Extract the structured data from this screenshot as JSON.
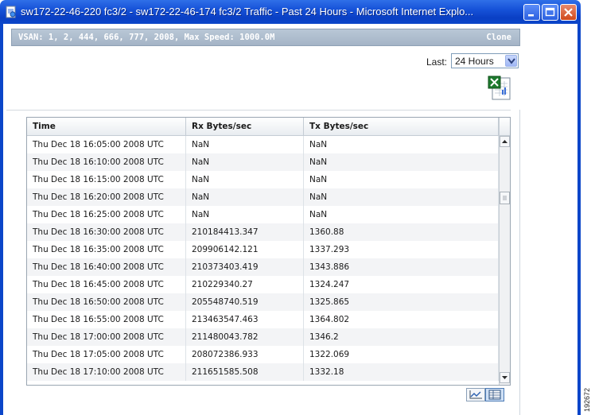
{
  "window": {
    "title": "sw172-22-46-220 fc3/2 - sw172-22-46-174 fc3/2 Traffic - Past 24 Hours - Microsoft Internet Explo..."
  },
  "header": {
    "vsan_info": "VSAN: 1, 2, 444, 666, 777, 2008, Max Speed: 1000.0M",
    "clone_label": "Clone"
  },
  "filter": {
    "last_label": "Last:",
    "selected": "24 Hours"
  },
  "table": {
    "columns": [
      "Time",
      "Rx Bytes/sec",
      "Tx Bytes/sec"
    ],
    "rows": [
      [
        "Thu Dec 18 16:05:00 2008 UTC",
        "NaN",
        "NaN"
      ],
      [
        "Thu Dec 18 16:10:00 2008 UTC",
        "NaN",
        "NaN"
      ],
      [
        "Thu Dec 18 16:15:00 2008 UTC",
        "NaN",
        "NaN"
      ],
      [
        "Thu Dec 18 16:20:00 2008 UTC",
        "NaN",
        "NaN"
      ],
      [
        "Thu Dec 18 16:25:00 2008 UTC",
        "NaN",
        "NaN"
      ],
      [
        "Thu Dec 18 16:30:00 2008 UTC",
        "210184413.347",
        "1360.88"
      ],
      [
        "Thu Dec 18 16:35:00 2008 UTC",
        "209906142.121",
        "1337.293"
      ],
      [
        "Thu Dec 18 16:40:00 2008 UTC",
        "210373403.419",
        "1343.886"
      ],
      [
        "Thu Dec 18 16:45:00 2008 UTC",
        "210229340.27",
        "1324.247"
      ],
      [
        "Thu Dec 18 16:50:00 2008 UTC",
        "205548740.519",
        "1325.865"
      ],
      [
        "Thu Dec 18 16:55:00 2008 UTC",
        "213463547.463",
        "1364.802"
      ],
      [
        "Thu Dec 18 17:00:00 2008 UTC",
        "211480043.782",
        "1346.2"
      ],
      [
        "Thu Dec 18 17:05:00 2008 UTC",
        "208072386.933",
        "1322.069"
      ],
      [
        "Thu Dec 18 17:10:00 2008 UTC",
        "211651585.508",
        "1332.18"
      ]
    ]
  },
  "icons": {
    "app": "ie-page-icon",
    "export": "excel-export-icon",
    "chart_view": "line-chart-icon",
    "table_view": "table-view-icon"
  },
  "watermark": "192672",
  "colors": {
    "titlebar": "#0a3fc4",
    "header_bar": "#a4b4c6",
    "alt_row": "#f3f4f6"
  }
}
